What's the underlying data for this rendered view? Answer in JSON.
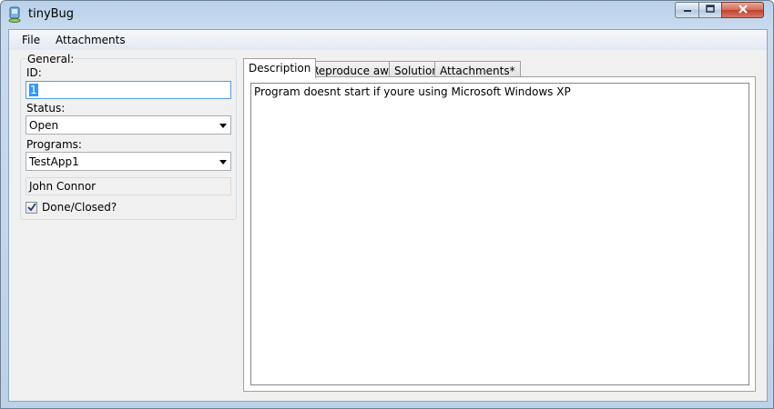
{
  "window": {
    "title": "tinyBug"
  },
  "menu": {
    "file": "File",
    "attachments": "Attachments"
  },
  "general": {
    "group_label": "General:",
    "id_label": "ID:",
    "id_value": "1",
    "status_label": "Status:",
    "status_value": "Open",
    "programs_label": "Programs:",
    "programs_value": "TestApp1",
    "assignee": "John Connor",
    "done_label": "Done/Closed?",
    "done_checked": true
  },
  "tabs": [
    {
      "label": "Description",
      "active": true
    },
    {
      "label": "Reproduce away",
      "active": false
    },
    {
      "label": "Solution",
      "active": false
    },
    {
      "label": "Attachments*",
      "active": false
    }
  ],
  "description": {
    "text": "Program doesnt start if youre using Microsoft Windows XP"
  },
  "icons": {
    "app": "bug-app-icon",
    "minimize": "minimize-icon",
    "maximize": "maximize-icon",
    "close": "close-icon",
    "dropdown": "chevron-down-icon",
    "check": "check-icon"
  },
  "colors": {
    "selection": "#3399ff",
    "titlebar": "#b9d1ea",
    "close_button": "#c0412a"
  }
}
